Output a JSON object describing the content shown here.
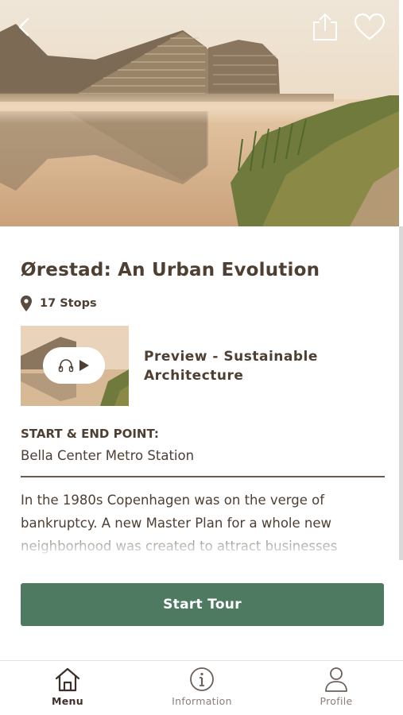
{
  "hero": {
    "image": "Waterfront housing block with terraced facade reflected in a misty canal at sunrise"
  },
  "tour": {
    "title": "Ørestad: An Urban Evolution",
    "stops_label": "17 Stops",
    "preview_label_line1": "Preview - Sustainable",
    "preview_label_line2": "Architecture",
    "start_end_heading": "START & END POINT:",
    "start_end_value": "Bella Center Metro Station",
    "description": "In the 1980s Copenhagen was on the verge of bankruptcy. A new Master Plan for a whole new neighborhood was created to attract businesses",
    "start_button": "Start Tour"
  },
  "tabbar": {
    "items": [
      {
        "label": "Menu",
        "icon": "home-icon",
        "active": true
      },
      {
        "label": "Information",
        "icon": "info-icon",
        "active": false
      },
      {
        "label": "Profile",
        "icon": "profile-icon",
        "active": false
      }
    ]
  },
  "colors": {
    "primary_button": "#4e7a62",
    "text": "#4e3f33"
  }
}
